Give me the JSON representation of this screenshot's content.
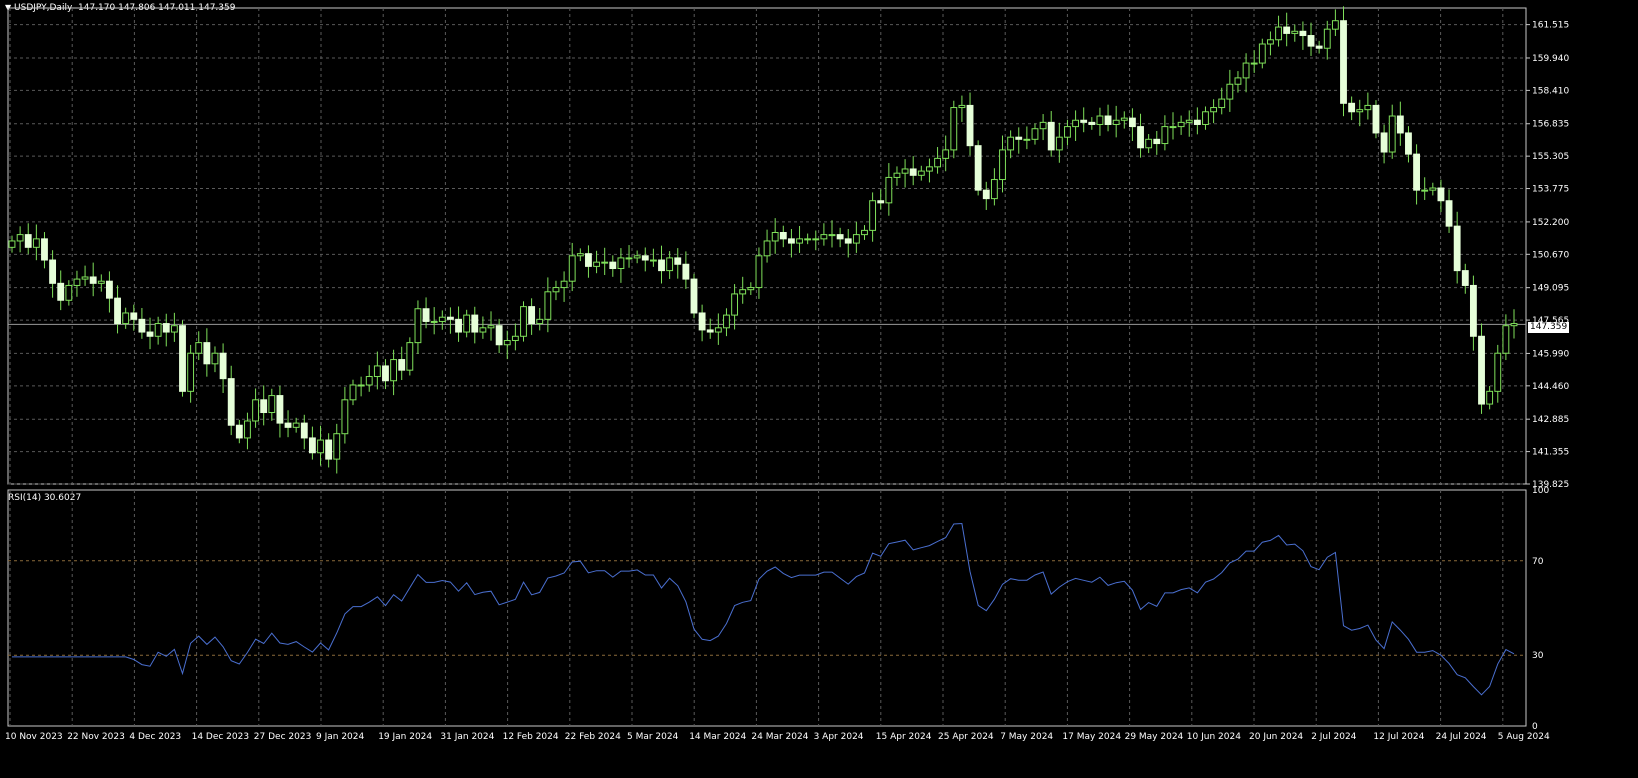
{
  "header": {
    "menu_icon": "triangle-down-icon",
    "symbol": "USDJPY,Daily",
    "ohlc": "147.170 147.806 147.011 147.359"
  },
  "indicator": {
    "label": "RSI(14) 30.6027"
  },
  "colors": {
    "background": "#000000",
    "grid": "#5a5a5a",
    "frame": "#c8c8c8",
    "bull": "#e6ffd9",
    "bull_stroke": "#7fe05a",
    "wick": "#7fe05a",
    "rsi_line": "#4a6fd0",
    "level_line": "#8a6a3a",
    "text": "#ffffff"
  },
  "price_axis": [
    "161.515",
    "159.940",
    "158.410",
    "156.835",
    "155.305",
    "153.775",
    "152.200",
    "150.670",
    "149.095",
    "147.565",
    "145.990",
    "144.460",
    "142.885",
    "141.355",
    "139.825"
  ],
  "current_price": "147.359",
  "rsi_axis": [
    "100",
    "70",
    "30",
    "0"
  ],
  "time_axis": [
    "10 Nov 2023",
    "22 Nov 2023",
    "4 Dec 2023",
    "14 Dec 2023",
    "27 Dec 2023",
    "9 Jan 2024",
    "19 Jan 2024",
    "31 Jan 2024",
    "12 Feb 2024",
    "22 Feb 2024",
    "5 Mar 2024",
    "14 Mar 2024",
    "24 Mar 2024",
    "3 Apr 2024",
    "15 Apr 2024",
    "25 Apr 2024",
    "7 May 2024",
    "17 May 2024",
    "29 May 2024",
    "10 Jun 2024",
    "20 Jun 2024",
    "2 Jul 2024",
    "12 Jul 2024",
    "24 Jul 2024",
    "5 Aug 2024"
  ],
  "chart_data": [
    {
      "type": "candlestick",
      "symbol": "USDJPY",
      "timeframe": "Daily",
      "ylim": [
        139.825,
        162.3
      ],
      "closes": [
        151.3,
        151.6,
        151.0,
        151.4,
        150.4,
        149.3,
        148.5,
        149.2,
        149.5,
        149.6,
        149.3,
        149.4,
        148.6,
        147.4,
        147.9,
        147.6,
        147.0,
        146.8,
        147.4,
        147.0,
        147.3,
        144.2,
        146.0,
        146.5,
        145.5,
        146.0,
        144.8,
        142.6,
        142.0,
        142.8,
        143.8,
        143.2,
        144.0,
        142.7,
        142.5,
        142.7,
        142.0,
        141.3,
        141.9,
        141.0,
        142.2,
        143.8,
        144.5,
        144.5,
        144.9,
        145.4,
        144.7,
        145.7,
        145.2,
        146.5,
        148.1,
        147.5,
        147.5,
        147.7,
        147.6,
        147.0,
        147.8,
        147.0,
        147.2,
        147.3,
        146.4,
        146.6,
        146.8,
        148.2,
        147.4,
        147.6,
        148.9,
        149.1,
        149.4,
        150.6,
        150.7,
        150.1,
        150.3,
        150.3,
        150.0,
        150.5,
        150.5,
        150.6,
        150.4,
        150.4,
        149.9,
        150.5,
        150.2,
        149.5,
        147.9,
        147.1,
        147.0,
        147.2,
        147.8,
        148.8,
        149.0,
        149.1,
        150.6,
        151.3,
        151.7,
        151.4,
        151.2,
        151.4,
        151.4,
        151.4,
        151.6,
        151.6,
        151.4,
        151.2,
        151.6,
        151.8,
        153.2,
        153.1,
        154.3,
        154.5,
        154.7,
        154.4,
        154.6,
        154.8,
        155.2,
        155.6,
        157.6,
        157.7,
        155.8,
        153.7,
        153.3,
        154.2,
        155.6,
        156.2,
        156.1,
        156.1,
        156.6,
        156.9,
        155.6,
        156.2,
        156.7,
        157.0,
        156.9,
        156.8,
        157.2,
        156.8,
        157.0,
        157.1,
        156.7,
        155.7,
        156.1,
        155.9,
        156.7,
        156.7,
        156.9,
        157.0,
        156.8,
        157.4,
        157.6,
        158.0,
        158.7,
        159.0,
        159.7,
        159.7,
        160.6,
        160.8,
        161.4,
        161.1,
        161.2,
        161.0,
        160.5,
        160.4,
        161.3,
        161.7,
        157.8,
        157.4,
        157.5,
        157.7,
        156.4,
        155.5,
        157.2,
        156.4,
        155.4,
        153.7,
        153.7,
        153.8,
        153.2,
        152.0,
        149.9,
        149.2,
        146.8,
        143.6,
        144.2,
        146.0,
        147.3,
        147.4
      ],
      "rsi_current": 30.6027,
      "rsi_levels": [
        30,
        70
      ],
      "rsi_ylim": [
        0,
        100
      ]
    }
  ]
}
